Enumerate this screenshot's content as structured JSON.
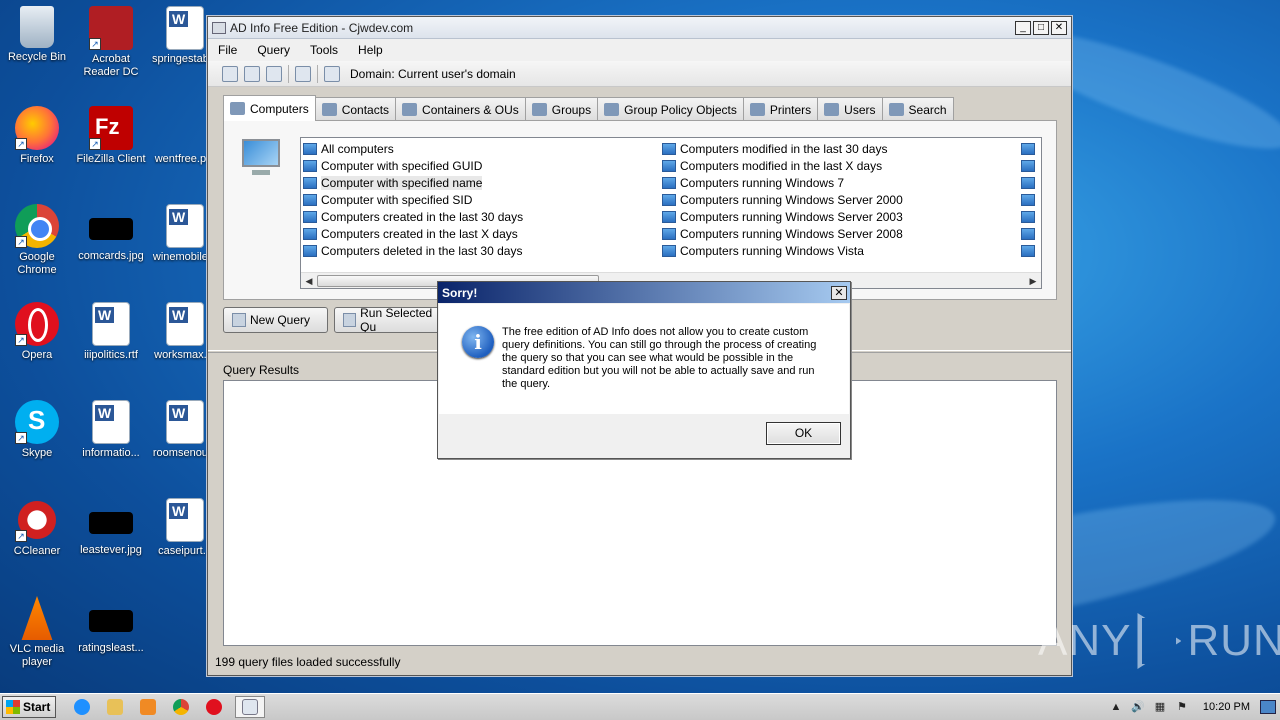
{
  "desktop": {
    "icons": [
      {
        "label": "Recycle Bin"
      },
      {
        "label": "Acrobat Reader DC"
      },
      {
        "label": "springestab..."
      },
      {
        "label": "Firefox"
      },
      {
        "label": "FileZilla Client"
      },
      {
        "label": "wentfree.p..."
      },
      {
        "label": "Google Chrome"
      },
      {
        "label": "comcards.jpg"
      },
      {
        "label": "winemobile..."
      },
      {
        "label": "Opera"
      },
      {
        "label": "iiipolitics.rtf"
      },
      {
        "label": "worksmax...."
      },
      {
        "label": "Skype"
      },
      {
        "label": "informatio..."
      },
      {
        "label": "roomsenou..."
      },
      {
        "label": "CCleaner"
      },
      {
        "label": "leastever.jpg"
      },
      {
        "label": "caseipurt..."
      },
      {
        "label": "VLC media player"
      },
      {
        "label": "ratingsleast..."
      }
    ]
  },
  "window": {
    "title": "AD Info Free Edition - Cjwdev.com",
    "menu": [
      "File",
      "Query",
      "Tools",
      "Help"
    ],
    "toolbar": {
      "domain_label": "Domain: Current user's domain"
    },
    "tabs": [
      "Computers",
      "Contacts",
      "Containers & OUs",
      "Groups",
      "Group Policy Objects",
      "Printers",
      "Users",
      "Search"
    ],
    "active_tab": "Computers",
    "queries_col1": [
      "All computers",
      "Computer with specified GUID",
      "Computer with specified name",
      "Computer with specified SID",
      "Computers created in the last 30 days",
      "Computers created in the last X days",
      "Computers deleted in the last 30 days"
    ],
    "queries_col2": [
      "Computers modified in the last 30 days",
      "Computers modified in the last X days",
      "Computers running Windows 7",
      "Computers running Windows Server 2000",
      "Computers running Windows Server 2003",
      "Computers running Windows Server 2008",
      "Computers running Windows Vista"
    ],
    "selected_query": "Computer with specified name",
    "new_query_label": "New Query",
    "run_query_label": "Run Selected Qu",
    "results_label": "Query Results",
    "status": "199 query files loaded successfully"
  },
  "dialog": {
    "title": "Sorry!",
    "message": "The free edition of AD Info does not allow you to create custom query definitions. You can still go through the process of creating the query so that you can see what would be possible in the standard edition but you will not be able to actually save and run the query.",
    "ok_label": "OK"
  },
  "taskbar": {
    "start_label": "Start",
    "clock": "10:20 PM"
  },
  "watermark": {
    "left": "ANY",
    "right": "RUN"
  },
  "colors": {
    "dialog_title_start": "#0a246a",
    "dialog_title_end": "#a6caf0",
    "desktop_blue": "#1a73c7"
  }
}
